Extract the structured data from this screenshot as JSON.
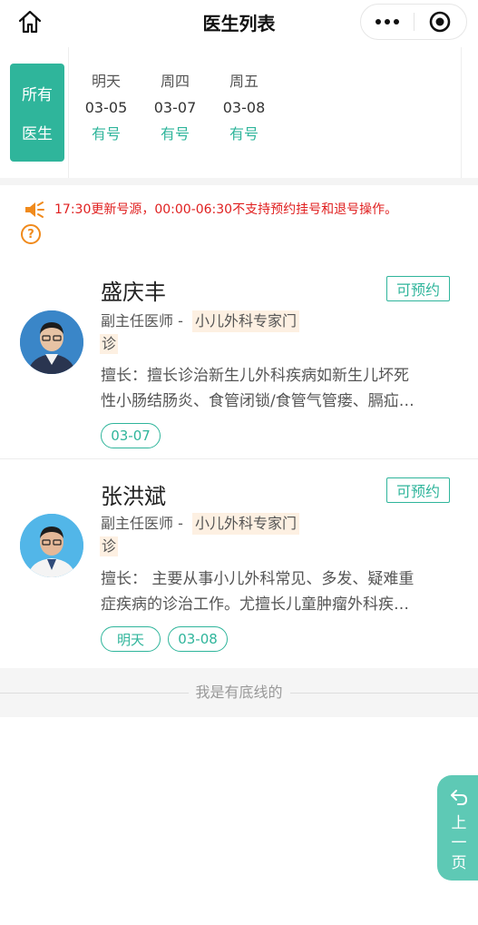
{
  "header": {
    "title": "医生列表"
  },
  "dates": {
    "all_label_line1": "所有",
    "all_label_line2": "医生",
    "columns": [
      {
        "weekday": "明天",
        "date": "03-05",
        "status": "有号"
      },
      {
        "weekday": "周四",
        "date": "03-07",
        "status": "有号"
      },
      {
        "weekday": "周五",
        "date": "03-08",
        "status": "有号"
      }
    ]
  },
  "notice": {
    "text": "17:30更新号源，00:00-06:30不支持预约挂号和退号操作。",
    "help_icon_text": "?"
  },
  "doctors": [
    {
      "name": "盛庆丰",
      "badge": "可预约",
      "title": "副主任医师 -",
      "dept_line1": "小儿外科专家门",
      "dept_line2": "诊",
      "desc_line1": "擅长：擅长诊治新生儿外科疾病如新生儿坏死",
      "desc_line2": "性小肠结肠炎、食管闭锁/食管气管瘘、膈疝…",
      "chips": [
        "03-07"
      ]
    },
    {
      "name": "张洪斌",
      "badge": "可预约",
      "title": "副主任医师 -",
      "dept_line1": "小儿外科专家门",
      "dept_line2": "诊",
      "desc_line1": "擅长： 主要从事小儿外科常见、多发、疑难重",
      "desc_line2": "症疾病的诊治工作。尤擅长儿童肿瘤外科疾…",
      "chips": [
        "明天",
        "03-08"
      ]
    }
  ],
  "footer": {
    "bottom_line_text": "我是有底线的"
  },
  "prev_page": {
    "label": "上一页"
  },
  "colors": {
    "brand": "#2fb59b",
    "notice": "#e02020",
    "help": "#f08a1c"
  }
}
